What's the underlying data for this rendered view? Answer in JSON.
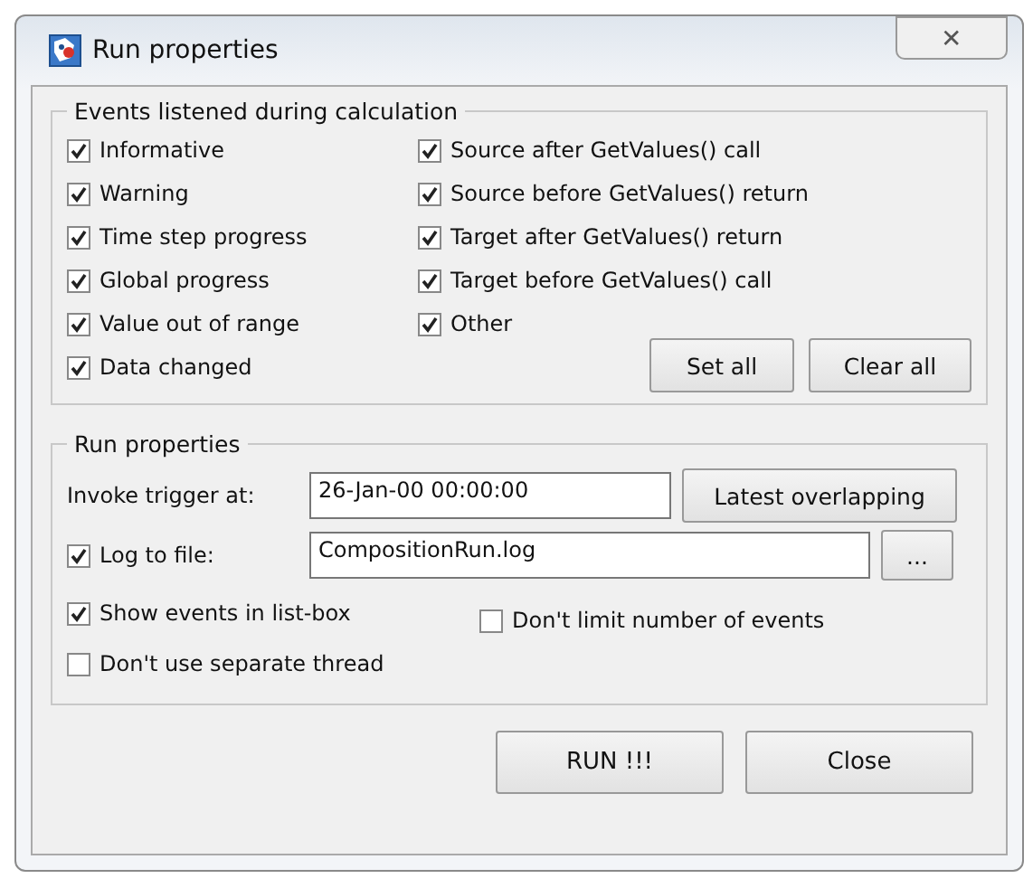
{
  "window": {
    "title": "Run properties",
    "close_label": "✕"
  },
  "events_group": {
    "legend": "Events listened during calculation",
    "left": [
      {
        "label": "Informative",
        "checked": true
      },
      {
        "label": "Warning",
        "checked": true
      },
      {
        "label": "Time step progress",
        "checked": true
      },
      {
        "label": "Global progress",
        "checked": true
      },
      {
        "label": "Value out of range",
        "checked": true
      },
      {
        "label": "Data changed",
        "checked": true
      }
    ],
    "right": [
      {
        "label": "Source after GetValues() call",
        "checked": true
      },
      {
        "label": "Source before GetValues() return",
        "checked": true
      },
      {
        "label": "Target after GetValues() return",
        "checked": true
      },
      {
        "label": "Target before GetValues() call",
        "checked": true
      },
      {
        "label": "Other",
        "checked": true
      }
    ],
    "buttons": [
      "Set all",
      "Clear all"
    ]
  },
  "run_group": {
    "legend": "Run properties",
    "trigger_label": "Invoke trigger at:",
    "trigger_value": "26-Jan-00 00:00:00",
    "trigger_button": "Latest overlapping",
    "log": {
      "label": "Log to file:",
      "checked": true
    },
    "log_value": "CompositionRun.log",
    "browse_button": "...",
    "show_events": {
      "label": "Show events in list-box",
      "checked": true
    },
    "no_limit": {
      "label": "Don't limit number of events",
      "checked": false
    },
    "no_thread": {
      "label": "Don't use separate thread",
      "checked": false
    }
  },
  "buttons": [
    "RUN !!!",
    "Close"
  ]
}
